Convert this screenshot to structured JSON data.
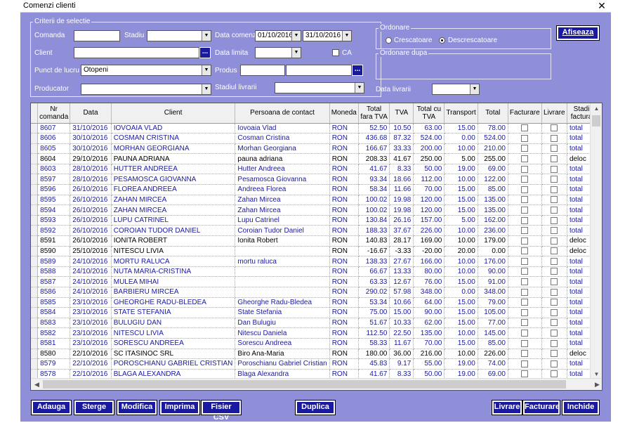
{
  "window": {
    "title": "Comenzi clienti",
    "close_icon": "close-icon"
  },
  "criteria": {
    "legend": "Criterii de selectie",
    "comanda_label": "Comanda",
    "comanda_value": "",
    "stadiu_label": "Stadiu",
    "stadiu_value": "",
    "data_comenzii_label": "Data comenzii",
    "date_from": "01/10/2016",
    "date_to": "31/10/2016",
    "client_label": "Client",
    "client_value": "",
    "data_limita_label": "Data limita",
    "data_limita_value": "",
    "ca_label": "CA",
    "punct_label": "Punct de lucru",
    "punct_value": "Otopeni",
    "produs_label": "Produs",
    "produs_value": "",
    "producator_label": "Producator",
    "producator_value": "",
    "stadiul_livrarii_label": "Stadiul livrarii",
    "stadiul_livrarii_value": "",
    "data_livrarii_label": "Data livrarii",
    "data_livrarii_value": ""
  },
  "ordering": {
    "legend": "Ordonare",
    "asc_label": "Crescatoare",
    "desc_label": "Descrescatoare",
    "selected": "Descrescatoare",
    "order_by_legend": "Ordonare dupa"
  },
  "afiseaza_label": "Afiseaza",
  "table": {
    "headers": [
      "Nr comanda",
      "Data",
      "Client",
      "Persoana de contact",
      "Moneda",
      "Total fara TVA",
      "TVA",
      "Total cu TVA",
      "Transport",
      "Total",
      "Facturare",
      "Livrare",
      "Stadiul facturarii"
    ],
    "rows": [
      {
        "nr": "8607",
        "data": "31/10/2016",
        "client": "IOVOAIA VLAD",
        "contact": "Iovoaia Vlad",
        "moneda": "RON",
        "fara_tva": "52.50",
        "tva": "10.50",
        "cu_tva": "63.00",
        "transport": "15.00",
        "total": "78.00",
        "stadiu": "total",
        "color": "blue"
      },
      {
        "nr": "8606",
        "data": "30/10/2016",
        "client": "COSMAN CRISTINA",
        "contact": "Cosman Cristina",
        "moneda": "RON",
        "fara_tva": "436.68",
        "tva": "87.32",
        "cu_tva": "524.00",
        "transport": "0.00",
        "total": "524.00",
        "stadiu": "total",
        "color": "blue"
      },
      {
        "nr": "8605",
        "data": "30/10/2016",
        "client": "MORHAN GEORGIANA",
        "contact": "Morhan Georgiana",
        "moneda": "RON",
        "fara_tva": "166.67",
        "tva": "33.33",
        "cu_tva": "200.00",
        "transport": "10.00",
        "total": "210.00",
        "stadiu": "total",
        "color": "blue"
      },
      {
        "nr": "8604",
        "data": "29/10/2016",
        "client": "PAUNA ADRIANA",
        "contact": "pauna adriana",
        "moneda": "RON",
        "fara_tva": "208.33",
        "tva": "41.67",
        "cu_tva": "250.00",
        "transport": "5.00",
        "total": "255.00",
        "stadiu": "deloc",
        "color": "black"
      },
      {
        "nr": "8603",
        "data": "28/10/2016",
        "client": "HUTTER ANDREEA",
        "contact": "Hutter Andreea",
        "moneda": "RON",
        "fara_tva": "41.67",
        "tva": "8.33",
        "cu_tva": "50.00",
        "transport": "19.00",
        "total": "69.00",
        "stadiu": "total",
        "color": "blue"
      },
      {
        "nr": "8597",
        "data": "28/10/2016",
        "client": "PESAMOSCA GIOVANNA",
        "contact": "Pesamosca Giovanna",
        "moneda": "RON",
        "fara_tva": "93.34",
        "tva": "18.66",
        "cu_tva": "112.00",
        "transport": "10.00",
        "total": "122.00",
        "stadiu": "total",
        "color": "blue"
      },
      {
        "nr": "8596",
        "data": "26/10/2016",
        "client": "FLOREA ANDREEA",
        "contact": "Andreea Florea",
        "moneda": "RON",
        "fara_tva": "58.34",
        "tva": "11.66",
        "cu_tva": "70.00",
        "transport": "15.00",
        "total": "85.00",
        "stadiu": "total",
        "color": "blue"
      },
      {
        "nr": "8595",
        "data": "26/10/2016",
        "client": "ZAHAN MIRCEA",
        "contact": "Zahan Mircea",
        "moneda": "RON",
        "fara_tva": "100.02",
        "tva": "19.98",
        "cu_tva": "120.00",
        "transport": "15.00",
        "total": "135.00",
        "stadiu": "total",
        "color": "blue"
      },
      {
        "nr": "8594",
        "data": "26/10/2016",
        "client": "ZAHAN MIRCEA",
        "contact": "Zahan Mircea",
        "moneda": "RON",
        "fara_tva": "100.02",
        "tva": "19.98",
        "cu_tva": "120.00",
        "transport": "15.00",
        "total": "135.00",
        "stadiu": "total",
        "color": "blue"
      },
      {
        "nr": "8593",
        "data": "26/10/2016",
        "client": "LUPU CATRINEL",
        "contact": "Lupu Catrinel",
        "moneda": "RON",
        "fara_tva": "130.84",
        "tva": "26.16",
        "cu_tva": "157.00",
        "transport": "5.00",
        "total": "162.00",
        "stadiu": "total",
        "color": "blue"
      },
      {
        "nr": "8592",
        "data": "26/10/2016",
        "client": "COROIAN TUDOR DANIEL",
        "contact": "Coroian Tudor Daniel",
        "moneda": "RON",
        "fara_tva": "188.33",
        "tva": "37.67",
        "cu_tva": "226.00",
        "transport": "10.00",
        "total": "236.00",
        "stadiu": "total",
        "color": "blue"
      },
      {
        "nr": "8591",
        "data": "26/10/2016",
        "client": "IONITA ROBERT",
        "contact": "Ionita Robert",
        "moneda": "RON",
        "fara_tva": "140.83",
        "tva": "28.17",
        "cu_tva": "169.00",
        "transport": "10.00",
        "total": "179.00",
        "stadiu": "deloc",
        "color": "black"
      },
      {
        "nr": "8590",
        "data": "25/10/2016",
        "client": "NITESCU LIVIA",
        "contact": "",
        "moneda": "RON",
        "fara_tva": "-16.67",
        "tva": "-3.33",
        "cu_tva": "-20.00",
        "transport": "20.00",
        "total": "0.00",
        "stadiu": "deloc",
        "color": "black"
      },
      {
        "nr": "8589",
        "data": "24/10/2016",
        "client": "MORTU RALUCA",
        "contact": "mortu raluca",
        "moneda": "RON",
        "fara_tva": "138.33",
        "tva": "27.67",
        "cu_tva": "166.00",
        "transport": "10.00",
        "total": "176.00",
        "stadiu": "total",
        "color": "blue"
      },
      {
        "nr": "8588",
        "data": "24/10/2016",
        "client": "NUTA MARIA-CRISTINA",
        "contact": "",
        "moneda": "RON",
        "fara_tva": "66.67",
        "tva": "13.33",
        "cu_tva": "80.00",
        "transport": "10.00",
        "total": "90.00",
        "stadiu": "total",
        "color": "blue"
      },
      {
        "nr": "8587",
        "data": "24/10/2016",
        "client": "MULEA MIHAI",
        "contact": "",
        "moneda": "RON",
        "fara_tva": "63.33",
        "tva": "12.67",
        "cu_tva": "76.00",
        "transport": "15.00",
        "total": "91.00",
        "stadiu": "total",
        "color": "blue"
      },
      {
        "nr": "8586",
        "data": "24/10/2016",
        "client": "BARBIERU MIRCEA",
        "contact": "",
        "moneda": "RON",
        "fara_tva": "290.02",
        "tva": "57.98",
        "cu_tva": "348.00",
        "transport": "0.00",
        "total": "348.00",
        "stadiu": "total",
        "color": "blue"
      },
      {
        "nr": "8585",
        "data": "23/10/2016",
        "client": "GHEORGHE RADU-BLEDEA",
        "contact": "Gheorghe Radu-Bledea",
        "moneda": "RON",
        "fara_tva": "53.34",
        "tva": "10.66",
        "cu_tva": "64.00",
        "transport": "15.00",
        "total": "79.00",
        "stadiu": "total",
        "color": "blue"
      },
      {
        "nr": "8584",
        "data": "23/10/2016",
        "client": "STATE STEFANIA",
        "contact": "State Stefania",
        "moneda": "RON",
        "fara_tva": "75.00",
        "tva": "15.00",
        "cu_tva": "90.00",
        "transport": "15.00",
        "total": "105.00",
        "stadiu": "total",
        "color": "blue"
      },
      {
        "nr": "8583",
        "data": "23/10/2016",
        "client": "BULUGIU DAN",
        "contact": "Dan Bulugiu",
        "moneda": "RON",
        "fara_tva": "51.67",
        "tva": "10.33",
        "cu_tva": "62.00",
        "transport": "15.00",
        "total": "77.00",
        "stadiu": "total",
        "color": "blue"
      },
      {
        "nr": "8582",
        "data": "23/10/2016",
        "client": "NITESCU LIVIA",
        "contact": "Nitescu Daniela",
        "moneda": "RON",
        "fara_tva": "112.50",
        "tva": "22.50",
        "cu_tva": "135.00",
        "transport": "10.00",
        "total": "145.00",
        "stadiu": "total",
        "color": "blue"
      },
      {
        "nr": "8581",
        "data": "23/10/2016",
        "client": "SORESCU ANDREEA",
        "contact": "Sorescu Andreea",
        "moneda": "RON",
        "fara_tva": "58.33",
        "tva": "11.67",
        "cu_tva": "70.00",
        "transport": "15.00",
        "total": "85.00",
        "stadiu": "total",
        "color": "blue"
      },
      {
        "nr": "8580",
        "data": "22/10/2016",
        "client": "SC ITASINOC SRL",
        "contact": "Biro Ana-Maria",
        "moneda": "RON",
        "fara_tva": "180.00",
        "tva": "36.00",
        "cu_tva": "216.00",
        "transport": "10.00",
        "total": "226.00",
        "stadiu": "deloc",
        "color": "black"
      },
      {
        "nr": "8579",
        "data": "22/10/2016",
        "client": "POROSCHIANU GABRIEL CRISTIAN",
        "contact": "Poroschianu Gabriel Cristian",
        "moneda": "RON",
        "fara_tva": "45.83",
        "tva": "9.17",
        "cu_tva": "55.00",
        "transport": "19.00",
        "total": "74.00",
        "stadiu": "total",
        "color": "blue"
      },
      {
        "nr": "8578",
        "data": "22/10/2016",
        "client": "BLAGA ALEXANDRA",
        "contact": "Blaga Alexandra",
        "moneda": "RON",
        "fara_tva": "41.67",
        "tva": "8.33",
        "cu_tva": "50.00",
        "transport": "19.00",
        "total": "69.00",
        "stadiu": "total",
        "color": "blue"
      }
    ]
  },
  "buttons": {
    "adauga": "Adauga",
    "sterge": "Sterge",
    "modifica": "Modifica",
    "imprima": "Imprima",
    "fisier_csv": "Fisier CSV",
    "duplica": "Duplica",
    "livrare": "Livrare",
    "facturare": "Facturare",
    "inchide": "Inchide"
  },
  "colors": {
    "panel": "#8f8fd9",
    "button": "#1a1aa0",
    "row_blue": "#1a1aa0"
  }
}
